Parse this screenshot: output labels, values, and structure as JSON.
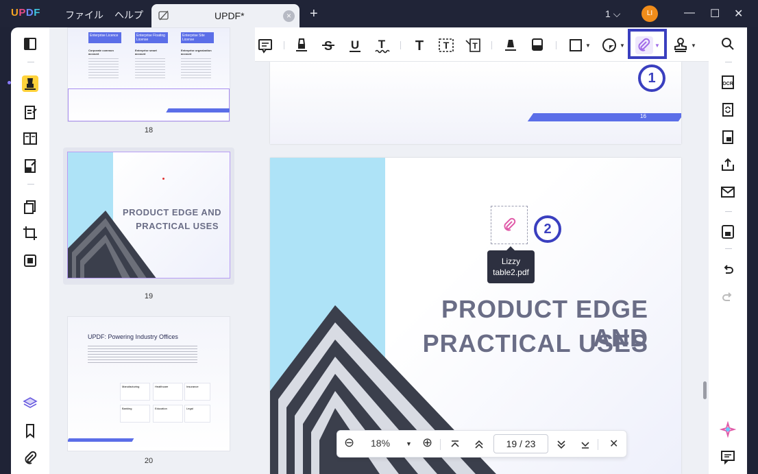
{
  "titlebar": {
    "app_name": "UPDF",
    "menu_file": "ファイル",
    "menu_help": "ヘルプ",
    "tab_title": "UPDF*",
    "tab_close": "×",
    "new_tab": "+",
    "page_count": "1",
    "avatar_initial": "LI",
    "minimize": "—",
    "maximize": "☐",
    "close": "✕"
  },
  "thumbnails": [
    {
      "number": "18",
      "labels": [
        "Enterprise Licence",
        "Enterprise Floating License",
        "Enterprise Site License"
      ],
      "subtitles": [
        "Corporate common account",
        "Enterprise smart account",
        "Enterprise organization account"
      ]
    },
    {
      "number": "19",
      "title": "PRODUCT EDGE AND\nPRACTICAL USES"
    },
    {
      "number": "20",
      "title": "UPDF: Powering Industry Offices",
      "industries": [
        "Manufacturing",
        "Healthcare",
        "Insurance",
        "Banking",
        "Education",
        "Legal"
      ]
    }
  ],
  "document": {
    "page_16_number": "16",
    "page_19_title_line1": "PRODUCT EDGE AND",
    "page_19_title_line2": "PRACTICAL USES",
    "attachment_tooltip_author": "Lizzy",
    "attachment_tooltip_file": "table2.pdf",
    "callout_1": "1",
    "callout_2": "2"
  },
  "zoombar": {
    "zoom_out": "⊖",
    "zoom_value": "18%",
    "zoom_in": "⊕",
    "current_page": "19",
    "separator": "/",
    "total_pages": "23",
    "close": "✕"
  },
  "colors": {
    "accent": "#3a3fbf",
    "attachment_pink": "#e05aa8",
    "page_title": "#6a6d86",
    "highlight_yellow": "#ffd23a"
  }
}
